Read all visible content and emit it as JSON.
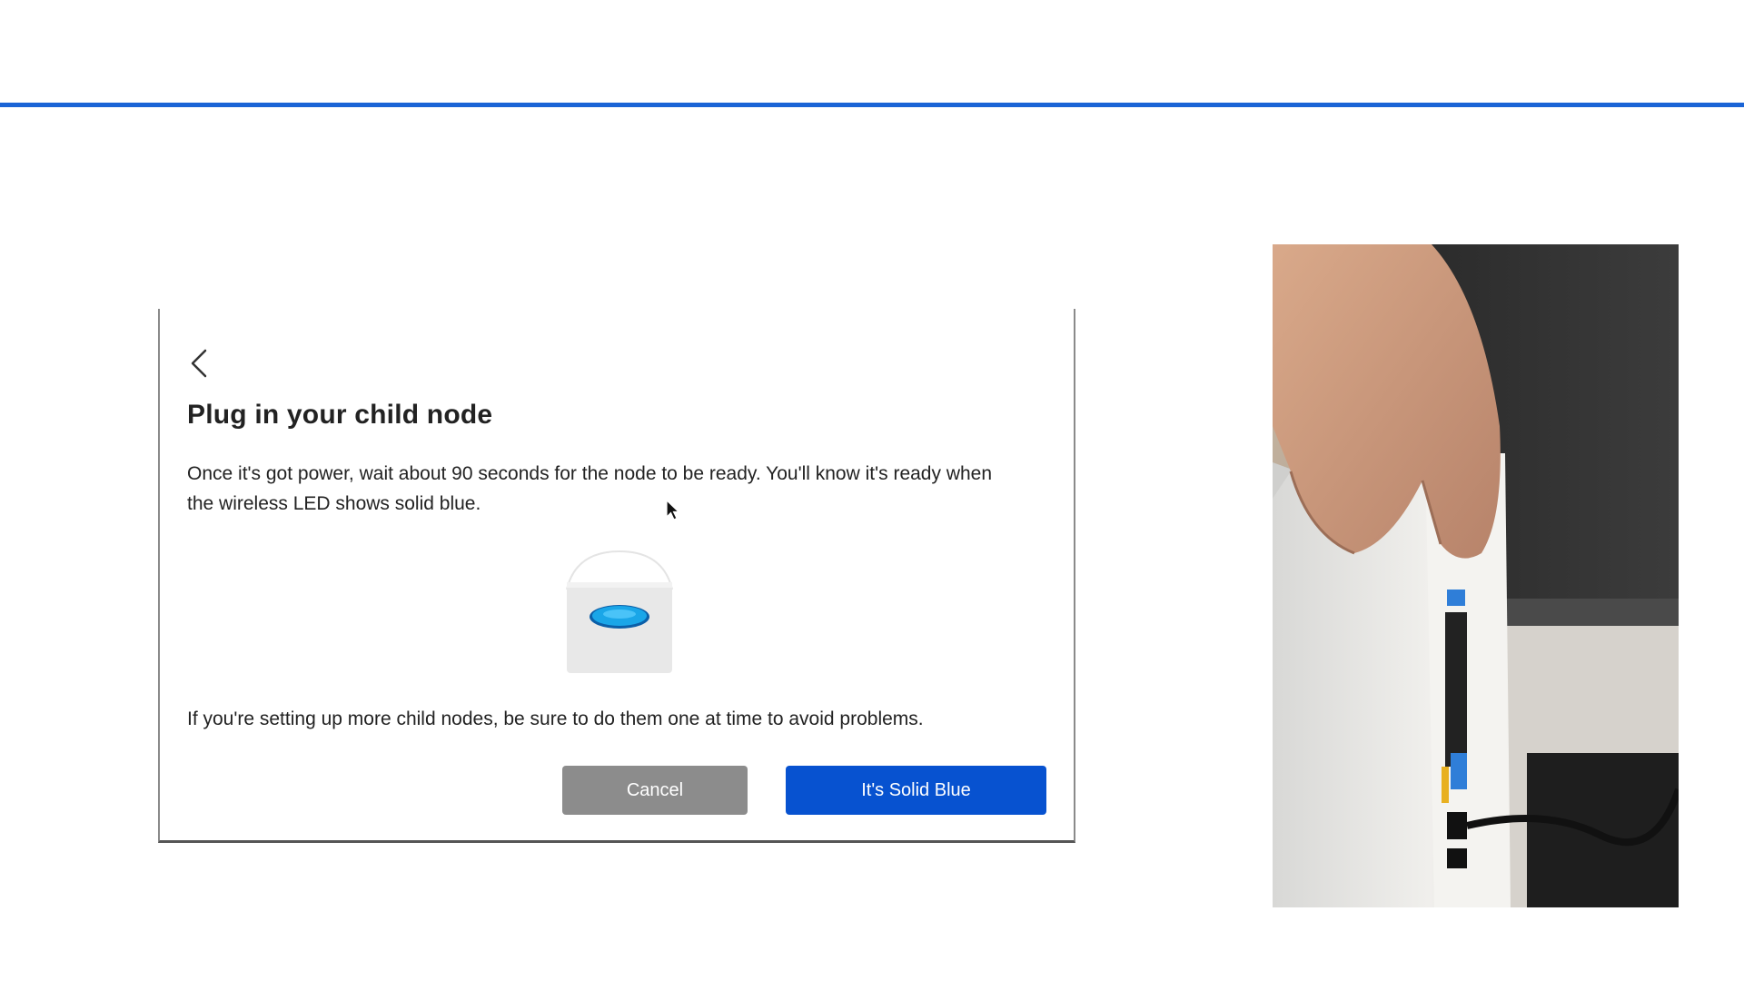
{
  "dialog": {
    "back_icon": "chevron-left-icon",
    "title": "Plug in your child node",
    "body": "Once it's got power, wait about 90 seconds for the node to be ready. You'll know it's ready when the wireless LED shows solid blue.",
    "illustration_icon": "node-led-icon",
    "note": "If you're setting up more child nodes, be sure to do them one at time to avoid problems.",
    "cancel_label": "Cancel",
    "confirm_label": "It's Solid Blue"
  },
  "colors": {
    "accent": "#0752d0",
    "rule": "#1a64d6",
    "cancel": "#8c8c8c",
    "led": "#1aa6e8"
  }
}
